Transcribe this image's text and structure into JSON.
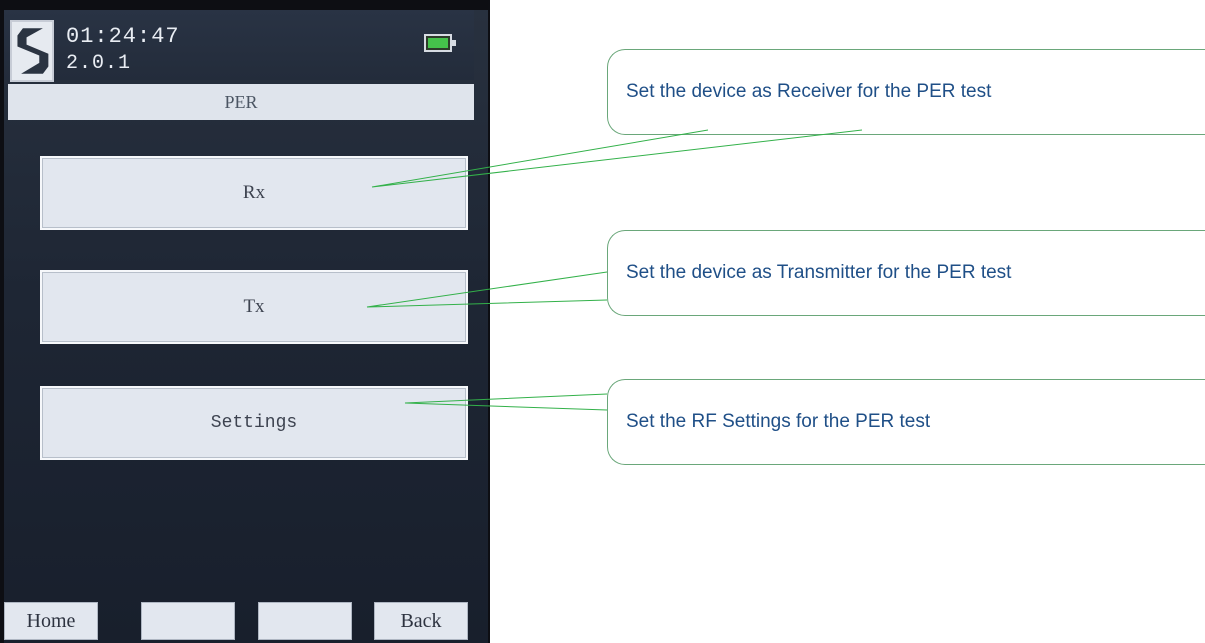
{
  "device": {
    "clock": "01:24:47",
    "version": "2.0.1",
    "screen_title": "PER",
    "menu": {
      "rx_label": "Rx",
      "tx_label": "Tx",
      "settings_label": "Settings"
    },
    "soft_keys": {
      "home_label": "Home",
      "key2_label": "",
      "key3_label": "",
      "back_label": "Back"
    }
  },
  "callouts": {
    "rx_text": "Set the device as Receiver for the PER test",
    "tx_text": "Set the device as Transmitter for the PER test",
    "settings_text": "Set the RF Settings for the PER test"
  },
  "colors": {
    "callout_border": "#6aa77a",
    "callout_text": "#1f4f87",
    "connector": "#33b14a",
    "battery_fill": "#45c24b"
  },
  "icons": {
    "logo": "s-logo-icon",
    "battery": "battery-icon"
  }
}
